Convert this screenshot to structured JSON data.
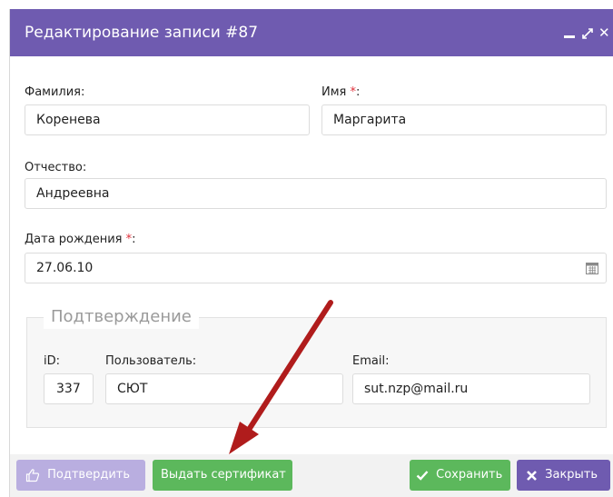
{
  "dialog": {
    "title": "Редактирование записи #87",
    "controls": {
      "minimize": "minimize",
      "maximize": "⤢",
      "close": "✕"
    }
  },
  "form": {
    "surname_label": "Фамилия:",
    "surname_value": "Коренева",
    "name_label": "Имя",
    "name_value": "Маргарита",
    "required_mark": "*",
    "colon": ":",
    "patronymic_label": "Отчество:",
    "patronymic_value": "Андреевна",
    "birthdate_label": "Дата рождения",
    "birthdate_value": "27.06.10"
  },
  "confirmation": {
    "legend": "Подтверждение",
    "id_label": "iD:",
    "id_value": "337",
    "user_label": "Пользователь:",
    "user_value": "СЮТ",
    "email_label": "Email:",
    "email_value": "sut.nzp@mail.ru"
  },
  "footer": {
    "confirm_label": "Подтвердить",
    "certificate_label": "Выдать сертификат",
    "save_label": "Сохранить",
    "close_label": "Закрыть"
  },
  "colors": {
    "accent": "#6f5bb0",
    "success": "#5cb85c",
    "disabled_accent": "#b9aee0",
    "annotation_arrow": "#b01c1c",
    "required": "#e0303a"
  },
  "icons": [
    "minimize-icon",
    "maximize-icon",
    "close-icon",
    "calendar-icon",
    "thumbs-up-icon",
    "check-icon",
    "x-icon",
    "annotation-arrow"
  ]
}
